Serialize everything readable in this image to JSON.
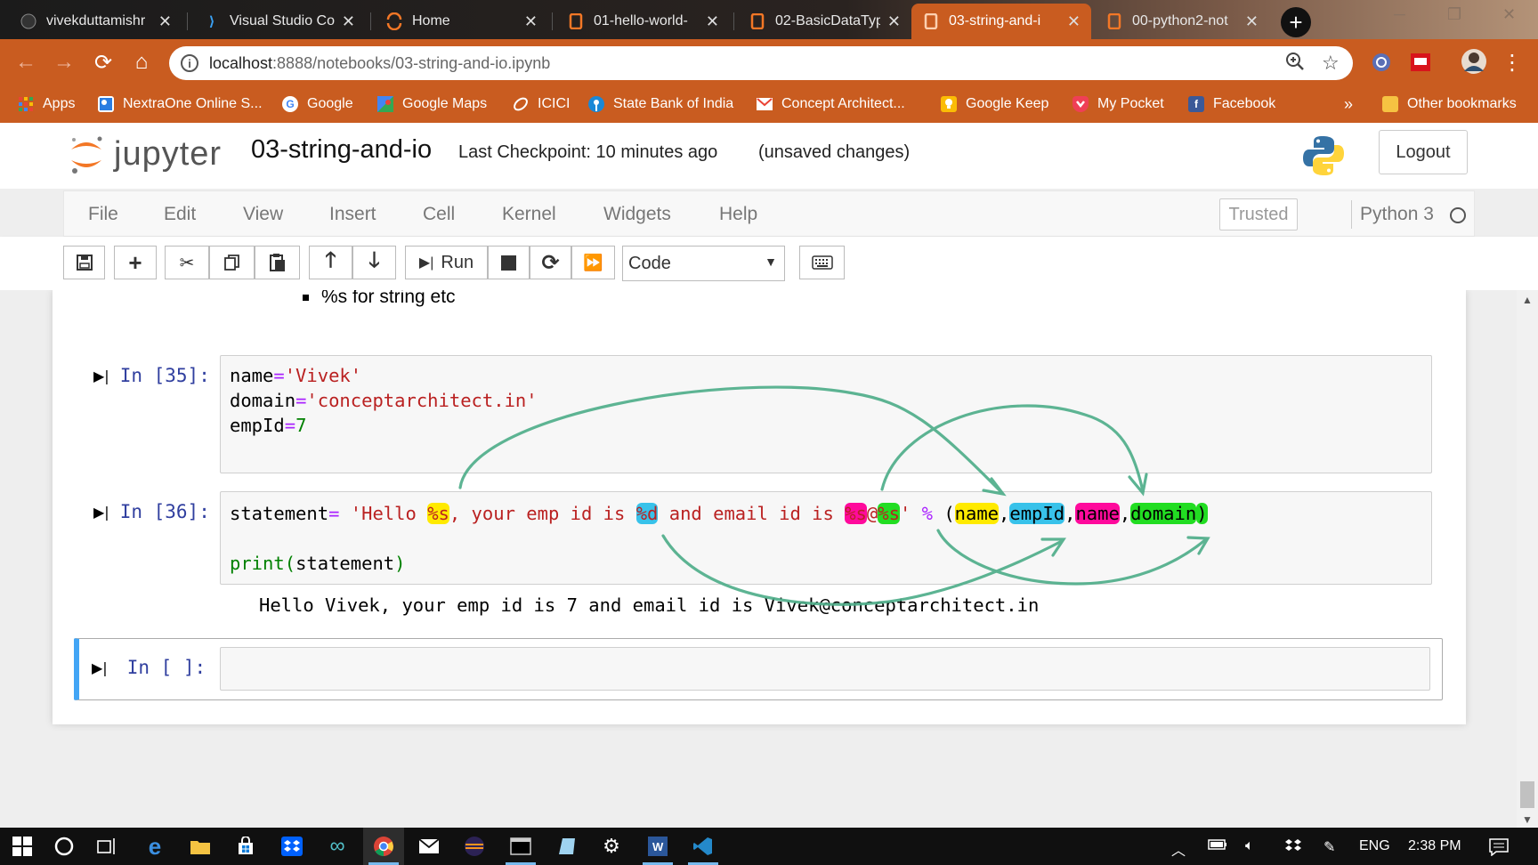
{
  "browser": {
    "tabs": [
      {
        "title": "vivekduttamishr",
        "icon": "github-icon",
        "active": false
      },
      {
        "title": "Visual Studio Co",
        "icon": "vscode-icon",
        "active": false
      },
      {
        "title": "Home",
        "icon": "jupyter-spinner-icon",
        "active": false
      },
      {
        "title": "01-hello-world-",
        "icon": "notebook-icon",
        "active": false
      },
      {
        "title": "02-BasicDataTyp",
        "icon": "notebook-icon",
        "active": false
      },
      {
        "title": "03-string-and-i",
        "icon": "notebook-icon",
        "active": true
      },
      {
        "title": "00-python2-not",
        "icon": "notebook-icon",
        "active": false
      }
    ],
    "address": {
      "host": "localhost",
      "path": ":8888/notebooks/03-string-and-io.ipynb"
    },
    "bookmarks": [
      {
        "label": "Apps",
        "icon": "apps-grid-icon"
      },
      {
        "label": "NextraOne Online S...",
        "icon": "nextraone-icon"
      },
      {
        "label": "Google",
        "icon": "google-icon"
      },
      {
        "label": "Google Maps",
        "icon": "google-maps-icon"
      },
      {
        "label": "ICICI",
        "icon": "icici-icon"
      },
      {
        "label": "State Bank of India",
        "icon": "sbi-icon"
      },
      {
        "label": "Concept Architect...",
        "icon": "gmail-icon"
      },
      {
        "label": "Google Keep",
        "icon": "keep-icon"
      },
      {
        "label": "My Pocket",
        "icon": "pocket-icon"
      },
      {
        "label": "Facebook",
        "icon": "facebook-icon"
      }
    ],
    "bookmarks_overflow": "»",
    "other_bookmarks": "Other bookmarks"
  },
  "jupyter": {
    "logo_text": "jupyter",
    "notebook_name": "03-string-and-io",
    "checkpoint": "Last Checkpoint: 10 minutes ago",
    "unsaved": "(unsaved changes)",
    "logout": "Logout",
    "menu": [
      "File",
      "Edit",
      "View",
      "Insert",
      "Cell",
      "Kernel",
      "Widgets",
      "Help"
    ],
    "trusted": "Trusted",
    "kernel": "Python 3",
    "toolbar": {
      "run_label": "Run",
      "cell_type": "Code"
    }
  },
  "notebook": {
    "markdown_bullet": "%s for string etc",
    "cell35": {
      "prompt": "In [35]:",
      "lines": {
        "l1_var": "name",
        "l1_op": "=",
        "l1_val": "'Vivek'",
        "l2_var": "domain",
        "l2_op": "=",
        "l2_val": "'conceptarchitect.in'",
        "l3_var": "empId",
        "l3_op": "=",
        "l3_val": "7"
      }
    },
    "cell36": {
      "prompt": "In [36]:",
      "s_var": "statement",
      "s_op": "=",
      "str_a": " 'Hello ",
      "fmt_s1": "%s",
      "str_b": ", your emp id is ",
      "fmt_d": "%d",
      "str_c": " and email id is ",
      "fmt_s2": "%s",
      "str_at": "@",
      "fmt_s3": "%s",
      "str_end": "'",
      "pct_op": "%",
      "lparen": "(",
      "arg1": "name",
      "comma1": ",",
      "arg2": "empId",
      "comma2": ",",
      "arg3": "name",
      "comma3": ",",
      "arg4": "domain",
      "rparen": ")",
      "print_fn": "print",
      "print_open": "(",
      "print_arg": "statement",
      "print_close": ")",
      "output": "Hello Vivek, your emp id is 7 and email id is Vivek@conceptarchitect.in"
    },
    "cell_empty": {
      "prompt": "In [ ]:"
    },
    "highlight_colors": {
      "yellow": "#ffea00",
      "blue": "#38c2ea",
      "pink": "#ff0a9c",
      "green": "#22dd22",
      "arrow": "#4fae8a"
    }
  },
  "taskbar": {
    "apps": [
      "start-icon",
      "cortana-icon",
      "task-view-icon",
      "edge-icon",
      "file-explorer-icon",
      "store-icon",
      "dropbox-icon",
      "infinity-app-icon",
      "chrome-icon",
      "mail-icon",
      "eclipse-icon",
      "terminal-icon",
      "notepad-icon",
      "settings-icon",
      "word-icon",
      "vscode-icon"
    ],
    "lang": "ENG",
    "time": "2:38 PM"
  }
}
